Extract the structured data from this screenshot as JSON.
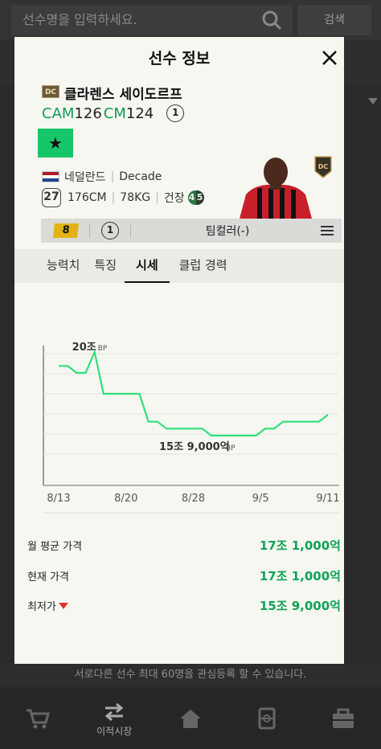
{
  "background": {
    "search_placeholder": "선수명을 입력하세요.",
    "search_button": "검색",
    "notice": "서로다른 선수 최대 60명을 관심등록 할 수 있습니다.",
    "nav": [
      {
        "label": "",
        "icon": "cart-icon"
      },
      {
        "label": "이적시장",
        "icon": "transfer-icon"
      },
      {
        "label": "",
        "icon": "home-icon"
      },
      {
        "label": "",
        "icon": "squad-icon"
      },
      {
        "label": "",
        "icon": "bag-icon"
      }
    ]
  },
  "modal": {
    "title": "선수 정보",
    "close_icon": "close-icon"
  },
  "player": {
    "season_badge": "DC",
    "name": "클라렌스 세이도르프",
    "positions": [
      {
        "pos": "CAM",
        "ovr": "126"
      },
      {
        "pos": "CM",
        "ovr": "124"
      }
    ],
    "upgrade_level": "1",
    "star": "★",
    "nation": "네덜란드",
    "season_name": "Decade",
    "age": "27",
    "height": "176CM",
    "weight": "78KG",
    "health_label": "건장",
    "foot_left": "4",
    "foot_right": "5"
  },
  "info_bar": {
    "grade": "8",
    "level": "1",
    "team_color": "팀컬러(-)"
  },
  "tabs": [
    {
      "label": "능력치",
      "active": false
    },
    {
      "label": "특징",
      "active": false
    },
    {
      "label": "시세",
      "active": true
    },
    {
      "label": "클럽 경력",
      "active": false
    }
  ],
  "chart_data": {
    "type": "line",
    "x_tick_labels": [
      "8/13",
      "8/20",
      "8/28",
      "9/5",
      "9/11"
    ],
    "unit": "BP",
    "series": [
      {
        "color": "#2fe07a",
        "values": [
          19.8,
          19.8,
          19.7,
          19.7,
          20.0,
          19.4,
          19.4,
          19.4,
          19.4,
          19.4,
          19.0,
          19.0,
          18.9,
          18.9,
          18.9,
          18.9,
          18.9,
          18.8,
          18.8,
          18.8,
          18.8,
          18.8,
          18.8,
          18.9,
          18.9,
          19.0,
          19.0,
          19.0,
          19.0,
          19.0,
          19.1
        ]
      }
    ],
    "annotations": {
      "high": {
        "value_label": "20조",
        "unit": "BP"
      },
      "low": {
        "value_label": "15조 9,000억",
        "unit": "BP"
      }
    }
  },
  "prices": [
    {
      "label": "월 평균 가격",
      "value": "17조 1,000억",
      "down_marker": false
    },
    {
      "label": "현재 가격",
      "value": "17조 1,000억",
      "down_marker": false
    },
    {
      "label": "최저가",
      "value": "15조 9,000억",
      "down_marker": true
    }
  ],
  "colors": {
    "accent_green": "#0fa356",
    "chart_line": "#2fe07a",
    "star_button": "#18c66a",
    "grade_gold": "#e2b313",
    "down_red": "#e0312f"
  }
}
